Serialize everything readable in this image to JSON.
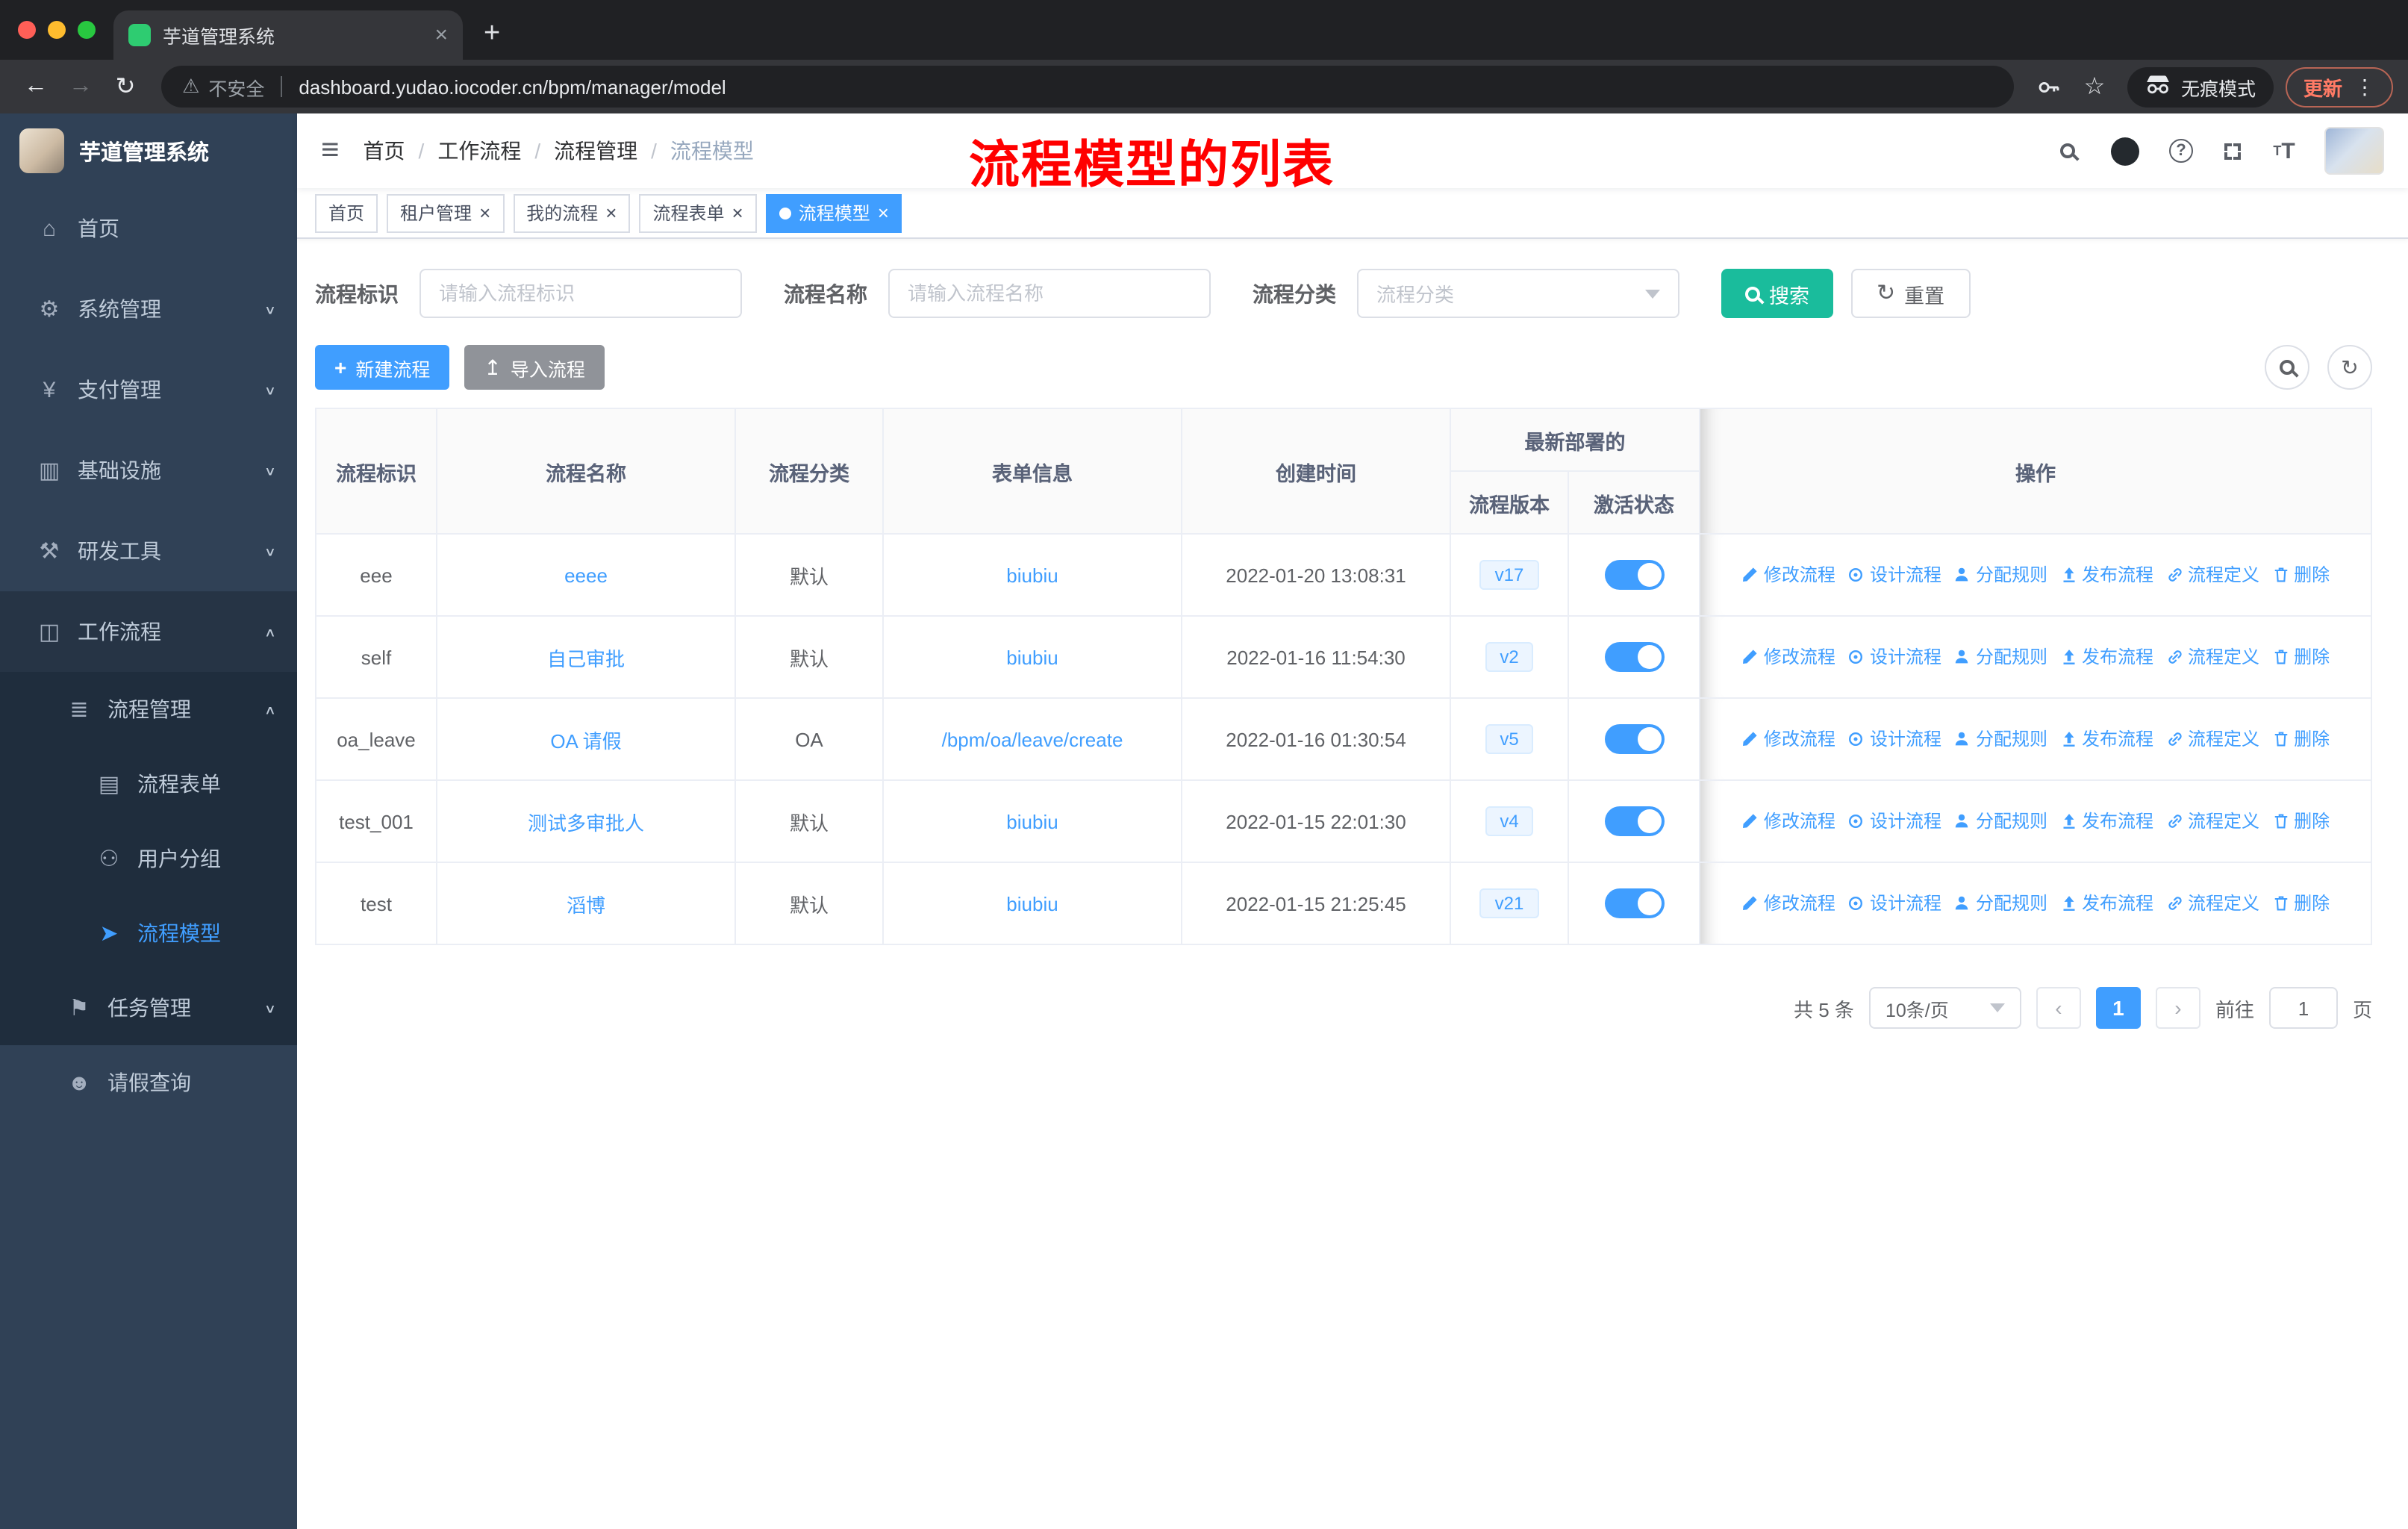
{
  "colors": {
    "primary": "#409eff",
    "search_button": "#1abc9c",
    "annotation": "#ff0000",
    "sidebar_bg": "#304156",
    "update_chip": "#ff7a65"
  },
  "browser": {
    "tab_title": "芋道管理系统",
    "security_label": "不安全",
    "url": "dashboard.yudao.iocoder.cn/bpm/manager/model",
    "incognito_label": "无痕模式",
    "update_label": "更新"
  },
  "sidebar": {
    "logo_title": "芋道管理系统",
    "items": [
      {
        "label": "首页",
        "icon": "dashboard-icon",
        "depth": 0,
        "bg": "root"
      },
      {
        "label": "系统管理",
        "icon": "gear-icon",
        "depth": 0,
        "bg": "root",
        "chevron": "down"
      },
      {
        "label": "支付管理",
        "icon": "yen-icon",
        "depth": 0,
        "bg": "root",
        "chevron": "down"
      },
      {
        "label": "基础设施",
        "icon": "monitor-icon",
        "depth": 0,
        "bg": "root",
        "chevron": "down"
      },
      {
        "label": "研发工具",
        "icon": "tools-icon",
        "depth": 0,
        "bg": "root",
        "chevron": "down"
      },
      {
        "label": "工作流程",
        "icon": "workflow-icon",
        "depth": 0,
        "bg": "open",
        "chevron": "up"
      },
      {
        "label": "流程管理",
        "icon": "list-icon",
        "depth": 1,
        "bg": "sub",
        "chevron": "up"
      },
      {
        "label": "流程表单",
        "icon": "form-icon",
        "depth": 2,
        "bg": "sub"
      },
      {
        "label": "用户分组",
        "icon": "user-group-icon",
        "depth": 2,
        "bg": "sub"
      },
      {
        "label": "流程模型",
        "icon": "paper-plane-icon",
        "depth": 2,
        "bg": "sub",
        "active": true
      },
      {
        "label": "任务管理",
        "icon": "task-icon",
        "depth": 1,
        "bg": "sub",
        "chevron": "down"
      },
      {
        "label": "请假查询",
        "icon": "person-icon",
        "depth": 1,
        "bg": "root"
      }
    ]
  },
  "navbar": {
    "breadcrumbs": [
      "首页",
      "工作流程",
      "流程管理",
      "流程模型"
    ],
    "annotation": "流程模型的列表"
  },
  "tags": {
    "items": [
      {
        "label": "首页",
        "closable": false,
        "active": false
      },
      {
        "label": "租户管理",
        "closable": true,
        "active": false
      },
      {
        "label": "我的流程",
        "closable": true,
        "active": false
      },
      {
        "label": "流程表单",
        "closable": true,
        "active": false
      },
      {
        "label": "流程模型",
        "closable": true,
        "active": true
      }
    ]
  },
  "filters": {
    "fields": [
      {
        "label": "流程标识",
        "placeholder": "请输入流程标识"
      },
      {
        "label": "流程名称",
        "placeholder": "请输入流程名称"
      },
      {
        "label": "流程分类",
        "placeholder": "流程分类"
      }
    ],
    "search_label": "搜索",
    "reset_label": "重置"
  },
  "toolbar": {
    "create_label": "新建流程",
    "import_label": "导入流程"
  },
  "table": {
    "columns": [
      "流程标识",
      "流程名称",
      "流程分类",
      "表单信息",
      "创建时间",
      "流程版本",
      "激活状态",
      "操作"
    ],
    "group_header": "最新部署的",
    "actions": [
      "修改流程",
      "设计流程",
      "分配规则",
      "发布流程",
      "流程定义",
      "删除"
    ],
    "rows": [
      {
        "key": "eee",
        "name": "eeee",
        "category": "默认",
        "form": "biubiu",
        "created": "2022-01-20 13:08:31",
        "version": "v17",
        "active": true
      },
      {
        "key": "self",
        "name": "自己审批",
        "category": "默认",
        "form": "biubiu",
        "created": "2022-01-16 11:54:30",
        "version": "v2",
        "active": true
      },
      {
        "key": "oa_leave",
        "name": "OA 请假",
        "category": "OA",
        "form": "/bpm/oa/leave/create",
        "created": "2022-01-16 01:30:54",
        "version": "v5",
        "active": true
      },
      {
        "key": "test_001",
        "name": "测试多审批人",
        "category": "默认",
        "form": "biubiu",
        "created": "2022-01-15 22:01:30",
        "version": "v4",
        "active": true
      },
      {
        "key": "test",
        "name": "滔博",
        "category": "默认",
        "form": "biubiu",
        "created": "2022-01-15 21:25:45",
        "version": "v21",
        "active": true
      }
    ]
  },
  "pagination": {
    "total_text": "共 5 条",
    "page_size": "10条/页",
    "current_page": "1",
    "goto_label": "前往",
    "goto_value": "1",
    "goto_suffix": "页"
  }
}
